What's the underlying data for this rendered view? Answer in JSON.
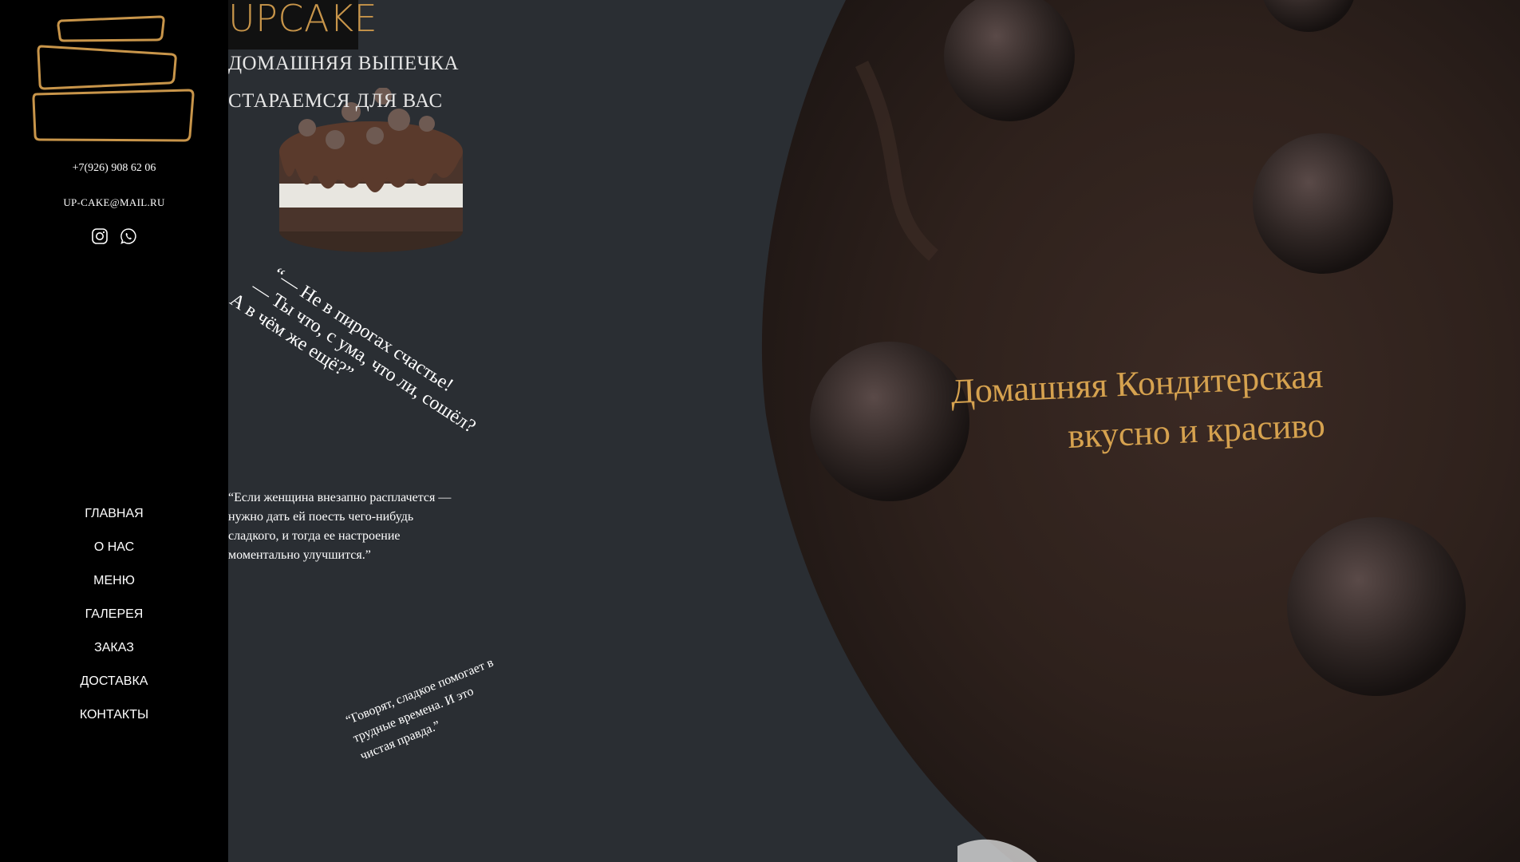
{
  "sidebar": {
    "phone": "+7(926) 908 62 06",
    "email": "UP-CAKE@MAIL.RU",
    "socials": [
      {
        "icon": "instagram-icon"
      },
      {
        "icon": "whatsapp-icon"
      }
    ],
    "nav": [
      {
        "label": "ГЛАВНАЯ"
      },
      {
        "label": "О НАС"
      },
      {
        "label": "МЕНЮ"
      },
      {
        "label": "ГАЛЕРЕЯ"
      },
      {
        "label": "ЗАКАЗ"
      },
      {
        "label": "ДОСТАВКА"
      },
      {
        "label": "КОНТАКТЫ"
      }
    ]
  },
  "header": {
    "brand": "UPCAKE",
    "subtitle1": "ДОМАШНЯЯ ВЫПЕЧКА",
    "subtitle2": "СТАРАЕМСЯ ДЛЯ ВАС"
  },
  "quotes": {
    "q1_line1": "“— Не в пирогах счастье!",
    "q1_line2": "— Ты что, с ума, что ли, сошёл?",
    "q1_line3": "А в чём же ещё?”",
    "q2": "“Если женщина внезапно расплачется — нужно дать ей поесть чего-нибудь сладкого, и тогда ее настроение моментально улучшится.”",
    "q3_line1": "“Говорят, сладкое помогает в",
    "q3_line2": "трудные времена. И это",
    "q3_line3": "чистая правда.”"
  },
  "hero": {
    "title_line1": "Домашняя Кондитерская",
    "title_line2": "вкусно и красиво"
  },
  "colors": {
    "accent": "#d6a24f",
    "sidebar_bg": "#000000",
    "page_bg": "#2a2e33"
  }
}
